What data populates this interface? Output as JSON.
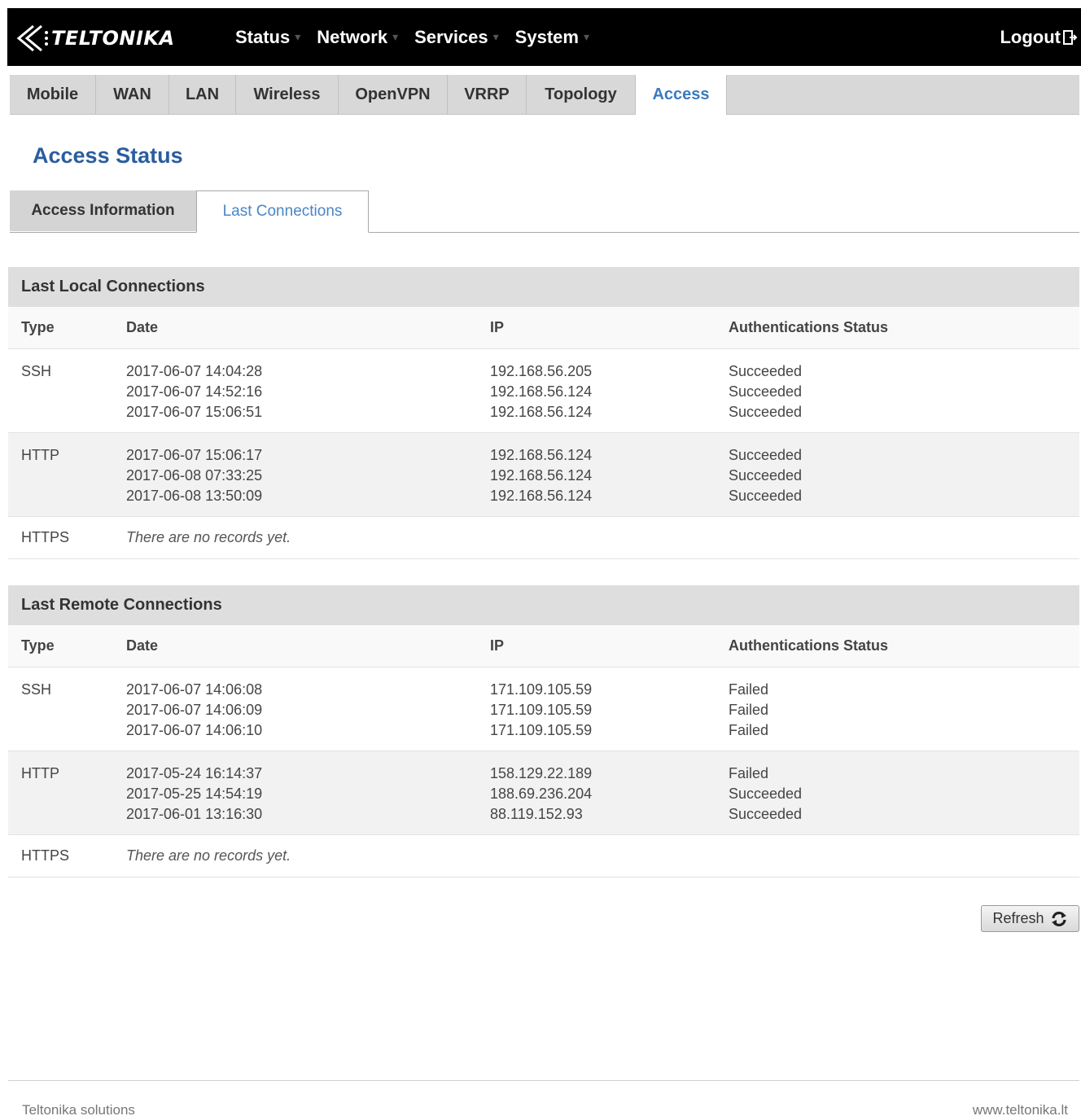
{
  "brand": {
    "name": "TELTONIKA"
  },
  "main_nav": [
    {
      "label": "Status"
    },
    {
      "label": "Network"
    },
    {
      "label": "Services"
    },
    {
      "label": "System"
    }
  ],
  "logout_label": "Logout",
  "sub_tabs": [
    {
      "label": "Mobile"
    },
    {
      "label": "WAN"
    },
    {
      "label": "LAN"
    },
    {
      "label": "Wireless"
    },
    {
      "label": "OpenVPN"
    },
    {
      "label": "VRRP"
    },
    {
      "label": "Topology"
    },
    {
      "label": "Access",
      "active": true
    }
  ],
  "page_title": "Access Status",
  "section_tabs": {
    "info": "Access Information",
    "last": "Last Connections"
  },
  "columns": {
    "type": "Type",
    "date": "Date",
    "ip": "IP",
    "status": "Authentications Status"
  },
  "local": {
    "title": "Last Local Connections",
    "rows": [
      {
        "type": "SSH",
        "dates": [
          "2017-06-07 14:04:28",
          "2017-06-07 14:52:16",
          "2017-06-07 15:06:51"
        ],
        "ips": [
          "192.168.56.205",
          "192.168.56.124",
          "192.168.56.124"
        ],
        "statuses": [
          "Succeeded",
          "Succeeded",
          "Succeeded"
        ]
      },
      {
        "type": "HTTP",
        "dates": [
          "2017-06-07 15:06:17",
          "2017-06-08 07:33:25",
          "2017-06-08 13:50:09"
        ],
        "ips": [
          "192.168.56.124",
          "192.168.56.124",
          "192.168.56.124"
        ],
        "statuses": [
          "Succeeded",
          "Succeeded",
          "Succeeded"
        ]
      },
      {
        "type": "HTTPS",
        "empty": "There are no records yet."
      }
    ]
  },
  "remote": {
    "title": "Last Remote Connections",
    "rows": [
      {
        "type": "SSH",
        "dates": [
          "2017-06-07 14:06:08",
          "2017-06-07 14:06:09",
          "2017-06-07 14:06:10"
        ],
        "ips": [
          "171.109.105.59",
          "171.109.105.59",
          "171.109.105.59"
        ],
        "statuses": [
          "Failed",
          "Failed",
          "Failed"
        ]
      },
      {
        "type": "HTTP",
        "dates": [
          "2017-05-24 16:14:37",
          "2017-05-25 14:54:19",
          "2017-06-01 13:16:30"
        ],
        "ips": [
          "158.129.22.189",
          "188.69.236.204",
          "88.119.152.93"
        ],
        "statuses": [
          "Failed",
          "Succeeded",
          "Succeeded"
        ]
      },
      {
        "type": "HTTPS",
        "empty": "There are no records yet."
      }
    ]
  },
  "refresh_label": "Refresh",
  "footer": {
    "left": "Teltonika solutions",
    "right": "www.teltonika.lt"
  },
  "colors": {
    "accent": "#2a5d9f",
    "active_tab": "#3a7bbf",
    "topbar": "#000000"
  }
}
